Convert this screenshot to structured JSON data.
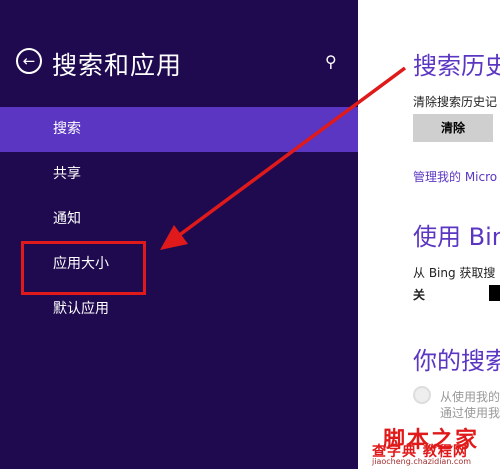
{
  "sidebar": {
    "title": "搜索和应用",
    "back_icon_glyph": "←",
    "search_icon_glyph": "⚲",
    "items": [
      {
        "label": "搜索",
        "active": true
      },
      {
        "label": "共享",
        "active": false
      },
      {
        "label": "通知",
        "active": false
      },
      {
        "label": "应用大小",
        "active": false
      },
      {
        "label": "默认应用",
        "active": false
      }
    ]
  },
  "main": {
    "history_heading": "搜索历史",
    "clear_history_label": "清除搜索历史记",
    "clear_button": "清除",
    "manage_link": "管理我的 Micro",
    "bing_heading": "使用 Bing",
    "bing_desc": "从 Bing 获取搜",
    "toggle_state": "关",
    "your_search_heading": "你的搜索",
    "option1": "从使用我的",
    "option2": "通过使用我"
  },
  "watermark": {
    "title": "脚本之家",
    "subtitle": "查字典 教程网",
    "url": "jiaocheng.chazidian.com"
  },
  "colors": {
    "sidebar_bg": "#1f0a4f",
    "active_item": "#5b36c2",
    "accent": "#5b36c2",
    "annotation": "#e01a1a"
  }
}
